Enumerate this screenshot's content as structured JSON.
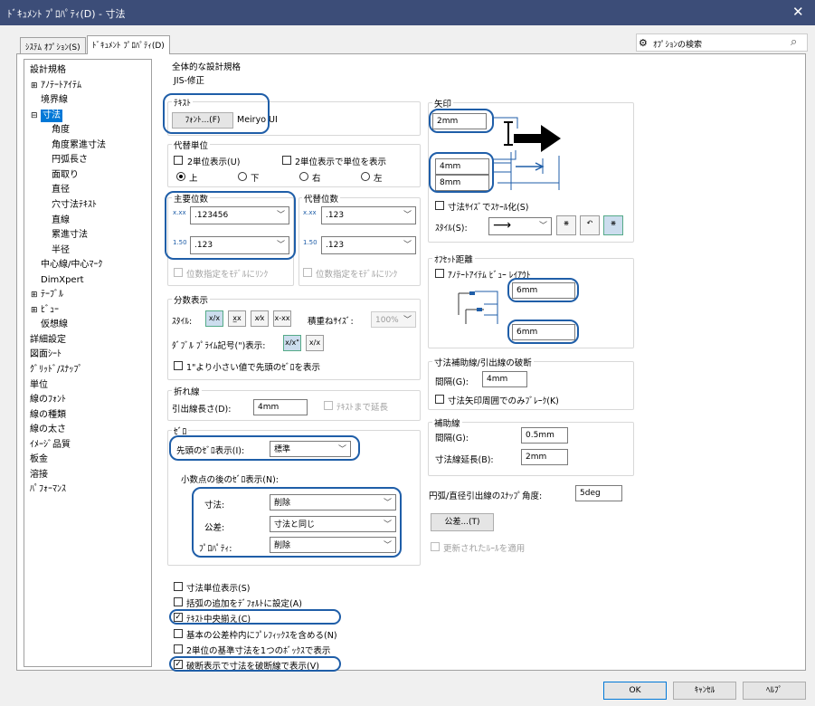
{
  "window": {
    "title": "ﾄﾞｷｭﾒﾝﾄ ﾌﾟﾛﾊﾟﾃｨ(D) - 寸法",
    "close": "✕"
  },
  "tabs": [
    {
      "label": "ｼｽﾃﾑ ｵﾌﾟｼｮﾝ(S)"
    },
    {
      "label": "ﾄﾞｷｭﾒﾝﾄ ﾌﾟﾛﾊﾟﾃｨ(D)"
    }
  ],
  "search": {
    "label": "ｵﾌﾟｼｮﾝの検索"
  },
  "tree": [
    {
      "label": "設計規格",
      "indent": 0
    },
    {
      "label": "ｱﾉﾃｰﾄｱｲﾃﾑ",
      "indent": 1,
      "exp": "⊞"
    },
    {
      "label": "境界線",
      "indent": 1
    },
    {
      "label": "寸法",
      "indent": 1,
      "exp": "⊟",
      "selected": true
    },
    {
      "label": "角度",
      "indent": 2
    },
    {
      "label": "角度累進寸法",
      "indent": 2
    },
    {
      "label": "円弧長さ",
      "indent": 2
    },
    {
      "label": "面取り",
      "indent": 2
    },
    {
      "label": "直径",
      "indent": 2
    },
    {
      "label": "穴寸法ﾃｷｽﾄ",
      "indent": 2
    },
    {
      "label": "直線",
      "indent": 2
    },
    {
      "label": "累進寸法",
      "indent": 2
    },
    {
      "label": "半径",
      "indent": 2
    },
    {
      "label": "中心線/中心ﾏｰｸ",
      "indent": 1
    },
    {
      "label": "DimXpert",
      "indent": 1
    },
    {
      "label": "ﾃｰﾌﾞﾙ",
      "indent": 1,
      "exp": "⊞"
    },
    {
      "label": "ﾋﾞｭｰ",
      "indent": 1,
      "exp": "⊞"
    },
    {
      "label": "仮想線",
      "indent": 1
    },
    {
      "label": "詳細設定",
      "indent": 0
    },
    {
      "label": "図面ｼｰﾄ",
      "indent": 0
    },
    {
      "label": "ｸﾞﾘｯﾄﾞ/ｽﾅｯﾌﾟ",
      "indent": 0
    },
    {
      "label": "単位",
      "indent": 0
    },
    {
      "label": "線のﾌｫﾝﾄ",
      "indent": 0
    },
    {
      "label": "線の種類",
      "indent": 0
    },
    {
      "label": "線の太さ",
      "indent": 0
    },
    {
      "label": "ｲﾒｰｼﾞ品質",
      "indent": 0
    },
    {
      "label": "板金",
      "indent": 0
    },
    {
      "label": "溶接",
      "indent": 0
    },
    {
      "label": "ﾊﾟﾌｫｰﾏﾝｽ",
      "indent": 0
    }
  ],
  "standard": {
    "title": "全体的な設計規格",
    "value": "JIS-修正"
  },
  "text": {
    "title": "ﾃｷｽﾄ",
    "font_btn": "ﾌｫﾝﾄ...(F)",
    "font_name": "Meiryo UI"
  },
  "alt": {
    "title": "代替単位",
    "dual": "2単位表示(U)",
    "dual_show": "2単位表示で単位を表示",
    "up": "上",
    "down": "下",
    "right": "右",
    "left": "左"
  },
  "primary": {
    "title": "主要位数",
    "v1": ".123456",
    "v2": ".123",
    "link": "位数指定をﾓﾃﾞﾙにﾘﾝｸ"
  },
  "altprec": {
    "title": "代替位数",
    "v1": ".123",
    "v2": ".123",
    "link": "位数指定をﾓﾃﾞﾙにﾘﾝｸ"
  },
  "fraction": {
    "title": "分数表示",
    "style": "ｽﾀｲﾙ:",
    "stack": "積重ねｻｲｽﾞ:",
    "stack_val": "100%",
    "double": "ﾀﾞﾌﾞﾙ ﾌﾟﾗｲﾑ記号(\")表示:",
    "leading": "1\"より小さい値で先頭のｾﾞﾛを表示"
  },
  "bent": {
    "title": "折れ線",
    "label": "引出線長さ(D):",
    "value": "4mm",
    "ext": "ﾃｷｽﾄまで延長"
  },
  "zero": {
    "title": "ｾﾞﾛ",
    "leading_label": "先頭のｾﾞﾛ表示(I):",
    "leading_val": "標準",
    "trailing": "小数点の後のｾﾞﾛ表示(N):",
    "dim": "寸法:",
    "dim_val": "削除",
    "tol": "公差:",
    "tol_val": "寸法と同じ",
    "prop": "ﾌﾟﾛﾊﾟﾃｨ:",
    "prop_val": "削除"
  },
  "checks": [
    {
      "label": "寸法単位表示(S)",
      "on": false
    },
    {
      "label": "括弧の追加をﾃﾞﾌｫﾙﾄに設定(A)",
      "on": false
    },
    {
      "label": "ﾃｷｽﾄ中央揃え(C)",
      "on": true
    },
    {
      "label": "基本の公差枠内にﾌﾟﾚﾌｨｯｸｽを含める(N)",
      "on": false
    },
    {
      "label": "2単位の基準寸法を1つのﾎﾞｯｸｽで表示",
      "on": false
    },
    {
      "label": "破断表示で寸法を破断線で表示(V)",
      "on": true
    }
  ],
  "arrows": {
    "title": "矢印",
    "v1": "2mm",
    "v2": "4mm",
    "v3": "8mm",
    "scale": "寸法ｻｲｽﾞでｽｹｰﾙ化(S)",
    "style": "ｽﾀｲﾙ(S):"
  },
  "offset": {
    "title": "ｵﾌｾｯﾄ距離",
    "layout": "ｱﾉﾃｰﾄｱｲﾃﾑ ﾋﾞｭｰ ﾚｲｱｳﾄ",
    "v1": "6mm",
    "v2": "6mm"
  },
  "break": {
    "title": "寸法補助線/引出線の破断",
    "gap": "間隔(G):",
    "gap_val": "4mm",
    "only": "寸法矢印周囲でのみﾌﾞﾚｰｸ(K)"
  },
  "ext": {
    "title": "補助線",
    "gap": "間隔(G):",
    "gap_val": "0.5mm",
    "beyond": "寸法線延長(B):",
    "beyond_val": "2mm"
  },
  "snap": {
    "label": "円弧/直径引出線のｽﾅｯﾌﾟ角度:",
    "value": "5deg"
  },
  "tolbtn": "公差...(T)",
  "update": "更新されたﾙｰﾙを適用",
  "footer": {
    "ok": "OK",
    "cancel": "ｷｬﾝｾﾙ",
    "help": "ﾍﾙﾌﾟ"
  }
}
